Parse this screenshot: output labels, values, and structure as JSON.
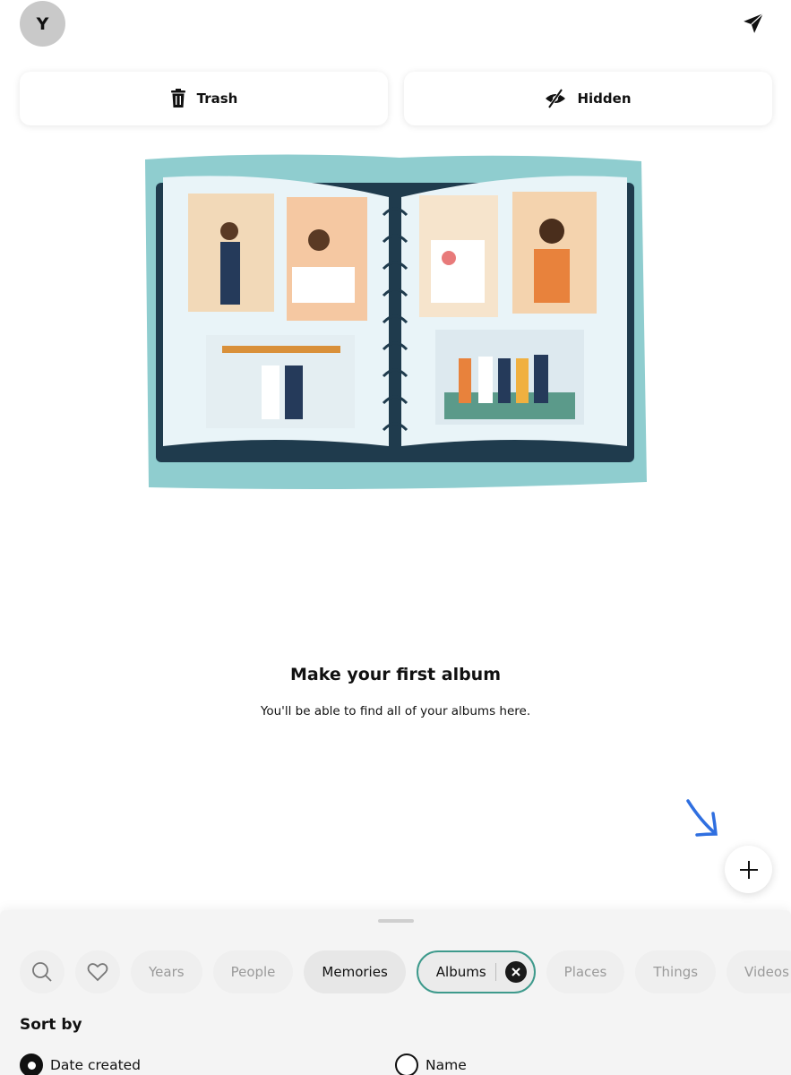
{
  "header": {
    "avatar_initial": "Y",
    "share_icon": "paper-plane-icon"
  },
  "actions": {
    "trash_label": "Trash",
    "trash_icon": "trash-icon",
    "hidden_label": "Hidden",
    "hidden_icon": "eye-slash-icon"
  },
  "empty_state": {
    "illustration": "photo-album-illustration",
    "title": "Make your first album",
    "subtitle": "You'll be able to find all of your albums here."
  },
  "fab": {
    "icon": "plus-icon",
    "hint_icon": "arrow-hint-icon",
    "hint_color": "#2f6fe0"
  },
  "filters": {
    "search_icon": "search-icon",
    "favorites_icon": "heart-icon",
    "chips": [
      {
        "label": "Years",
        "state": "default"
      },
      {
        "label": "People",
        "state": "default"
      },
      {
        "label": "Memories",
        "state": "active"
      },
      {
        "label": "Albums",
        "state": "selected"
      },
      {
        "label": "Places",
        "state": "default"
      },
      {
        "label": "Things",
        "state": "default"
      },
      {
        "label": "Videos",
        "state": "default"
      }
    ],
    "selected_border_color": "#3e9a8c"
  },
  "sort": {
    "label": "Sort by",
    "options": [
      {
        "label": "Date created",
        "checked": true
      },
      {
        "label": "Name",
        "checked": false
      }
    ]
  }
}
